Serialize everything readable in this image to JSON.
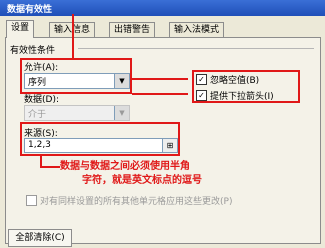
{
  "window": {
    "title": "数据有效性"
  },
  "tabs": [
    "设置",
    "输入信息",
    "出错警告",
    "输入法模式"
  ],
  "settings": {
    "group_title": "有效性条件",
    "allow_label": "允许(A):",
    "allow_value": "序列",
    "data_label": "数据(D):",
    "data_value": "介于",
    "ignore_blank_label": "忽略空值(B)",
    "ignore_blank_checked": true,
    "dropdown_label": "提供下拉箭头(I)",
    "dropdown_checked": true,
    "source_label": "来源(S):",
    "source_value": "1,2,3",
    "apply_all_label": "对有同样设置的所有其他单元格应用这些更改(P)",
    "clear_button": "全部清除(C)"
  },
  "annotation": {
    "note_line1": "数据与数据之间必须使用半角",
    "note_line2": "字符，就是英文标点的逗号"
  },
  "colors": {
    "accent": "#e01818",
    "titlebar": "#2a5dc9"
  }
}
